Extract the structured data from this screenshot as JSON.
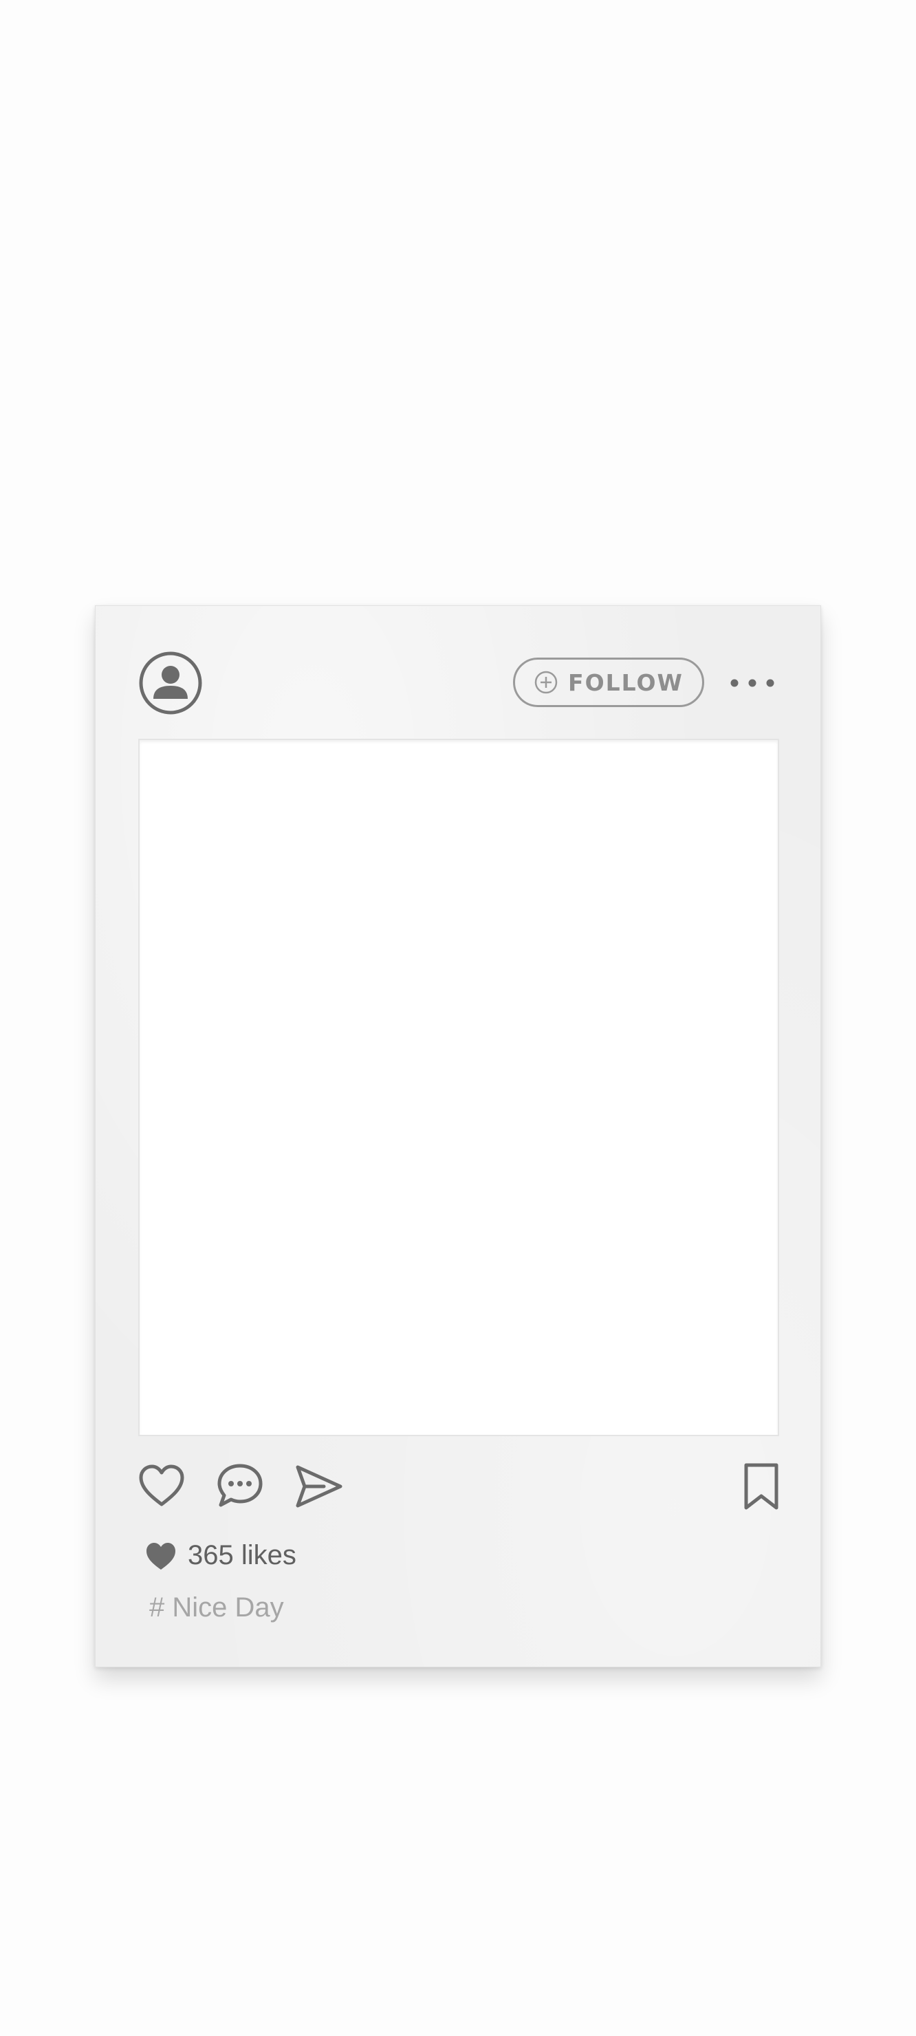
{
  "post": {
    "follow_label": "FOLLOW",
    "likes_text": "365 likes",
    "hashtag_text": "# Nice Day"
  },
  "icons": {
    "avatar": "user-avatar-icon",
    "follow": "plus-circle-icon",
    "more": "more-dots-icon",
    "like": "heart-outline-icon",
    "comment": "comment-bubble-icon",
    "share": "send-paper-plane-icon",
    "bookmark": "bookmark-icon",
    "likes": "heart-filled-icon"
  },
  "colors": {
    "card_background": "#efefef",
    "icon_gray": "#6b6b6b",
    "follow_gray": "#9a9a9a",
    "hashtag_gray": "#a6a6a6"
  }
}
